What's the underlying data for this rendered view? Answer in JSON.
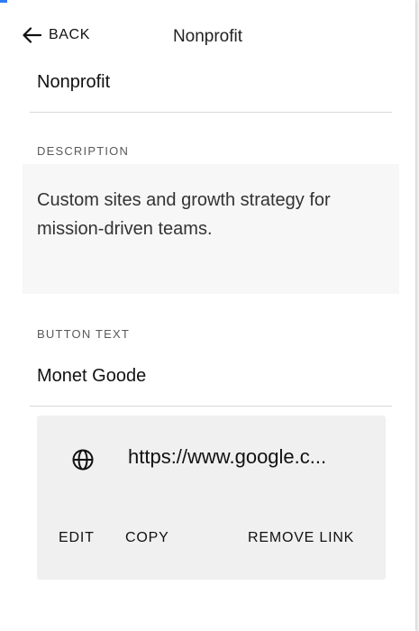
{
  "header": {
    "back_label": "BACK",
    "title": "Nonprofit"
  },
  "name_field": {
    "value": "Nonprofit"
  },
  "description": {
    "label": "DESCRIPTION",
    "text": "Custom sites and growth strategy for mission-driven teams."
  },
  "button": {
    "label": "BUTTON TEXT",
    "text": "Monet Goode"
  },
  "link": {
    "url_display": "https://www.google.c...",
    "actions": {
      "edit": "EDIT",
      "copy": "COPY",
      "remove": "REMOVE LINK"
    }
  },
  "icons": {
    "back": "arrow-left-icon",
    "link": "globe-icon"
  },
  "colors": {
    "accent": "#2f7cf6",
    "text": "#111111",
    "card_bg": "#f0f0f0",
    "desc_bg": "#f7f7f7"
  }
}
